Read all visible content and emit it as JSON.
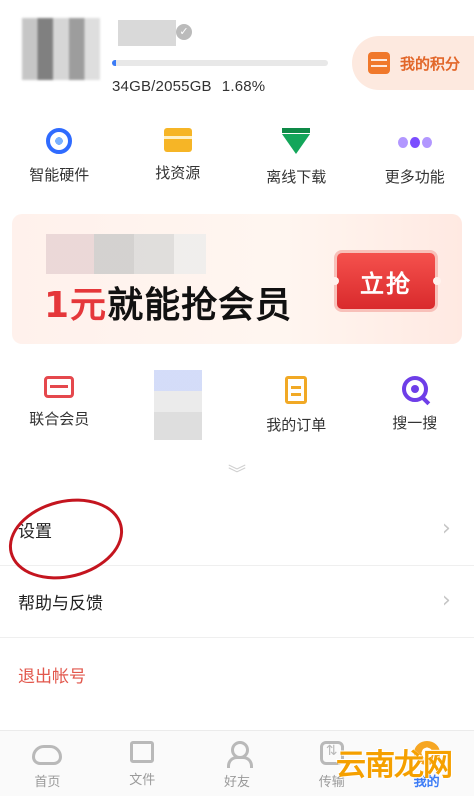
{
  "header": {
    "storage_used": "34GB/2055GB",
    "storage_percent": "1.68%",
    "storage_fraction": 0.0168,
    "points_label": "我的积分",
    "accent_color": "#e2672a"
  },
  "top_grid": [
    {
      "label": "智能硬件",
      "icon": "smart-hardware-icon"
    },
    {
      "label": "找资源",
      "icon": "find-resource-icon"
    },
    {
      "label": "离线下载",
      "icon": "offline-download-icon"
    },
    {
      "label": "更多功能",
      "icon": "more-features-icon"
    }
  ],
  "banner": {
    "price_text": "1元",
    "headline_text": "就能抢会员",
    "cta_label": "立抢"
  },
  "second_grid": [
    {
      "label": "联合会员",
      "icon": "joint-member-icon"
    },
    {
      "label": "",
      "icon": "blurred-icon"
    },
    {
      "label": "我的订单",
      "icon": "my-orders-icon"
    },
    {
      "label": "搜一搜",
      "icon": "search-icon"
    }
  ],
  "menu": {
    "settings": "设置",
    "help_feedback": "帮助与反馈",
    "logout": "退出帐号"
  },
  "bottom_nav": [
    {
      "label": "首页",
      "icon": "home-icon"
    },
    {
      "label": "文件",
      "icon": "files-icon"
    },
    {
      "label": "好友",
      "icon": "friends-icon"
    },
    {
      "label": "传输",
      "icon": "transfer-icon"
    },
    {
      "label": "我的",
      "icon": "mine-icon",
      "active": true
    }
  ],
  "watermark_text": "云南龙网"
}
